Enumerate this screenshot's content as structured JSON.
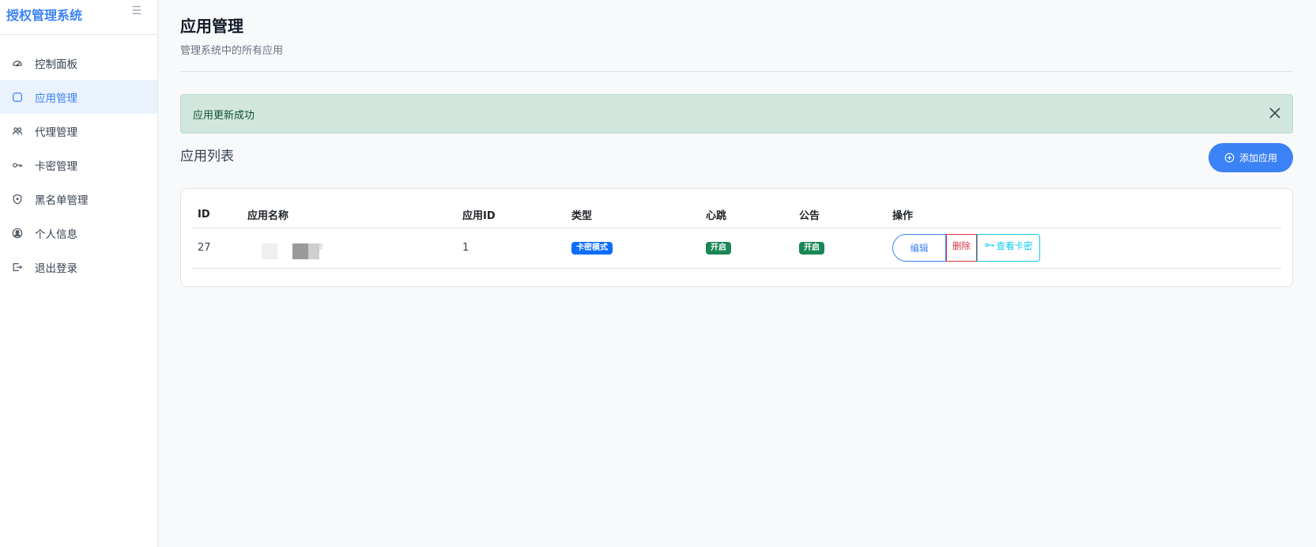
{
  "sidebar": {
    "brand": "授权管理系统",
    "toggle_icon": "menu-lines-icon",
    "items": [
      {
        "label": "控制面板",
        "icon": "dashboard-icon",
        "active": false
      },
      {
        "label": "应用管理",
        "icon": "square-icon",
        "active": true
      },
      {
        "label": "代理管理",
        "icon": "users-icon",
        "active": false
      },
      {
        "label": "卡密管理",
        "icon": "key-icon",
        "active": false
      },
      {
        "label": "黑名单管理",
        "icon": "shield-icon",
        "active": false
      },
      {
        "label": "个人信息",
        "icon": "user-circle-icon",
        "active": false
      },
      {
        "label": "退出登录",
        "icon": "logout-icon",
        "active": false
      }
    ]
  },
  "header": {
    "title": "应用管理",
    "subtitle": "管理系统中的所有应用"
  },
  "alert": {
    "message": "应用更新成功"
  },
  "list": {
    "title": "应用列表",
    "add_button": "添加应用"
  },
  "table": {
    "columns": [
      "ID",
      "应用名称",
      "应用ID",
      "类型",
      "心跳",
      "公告",
      "操作"
    ],
    "rows": [
      {
        "id": "27",
        "app_id": "1",
        "type": "卡密模式",
        "heartbeat": "开启",
        "notice": "开启",
        "actions": {
          "edit": "编辑",
          "delete": "删除",
          "view_keys": "查看卡密"
        }
      }
    ]
  },
  "colors": {
    "accent": "#3b82f6",
    "active_bg": "#eaf2fe",
    "alert_bg": "#d1e7dd",
    "danger": "#dc3545",
    "info": "#0dcaf0",
    "success": "#198754",
    "primary_badge": "#0d6efd"
  }
}
